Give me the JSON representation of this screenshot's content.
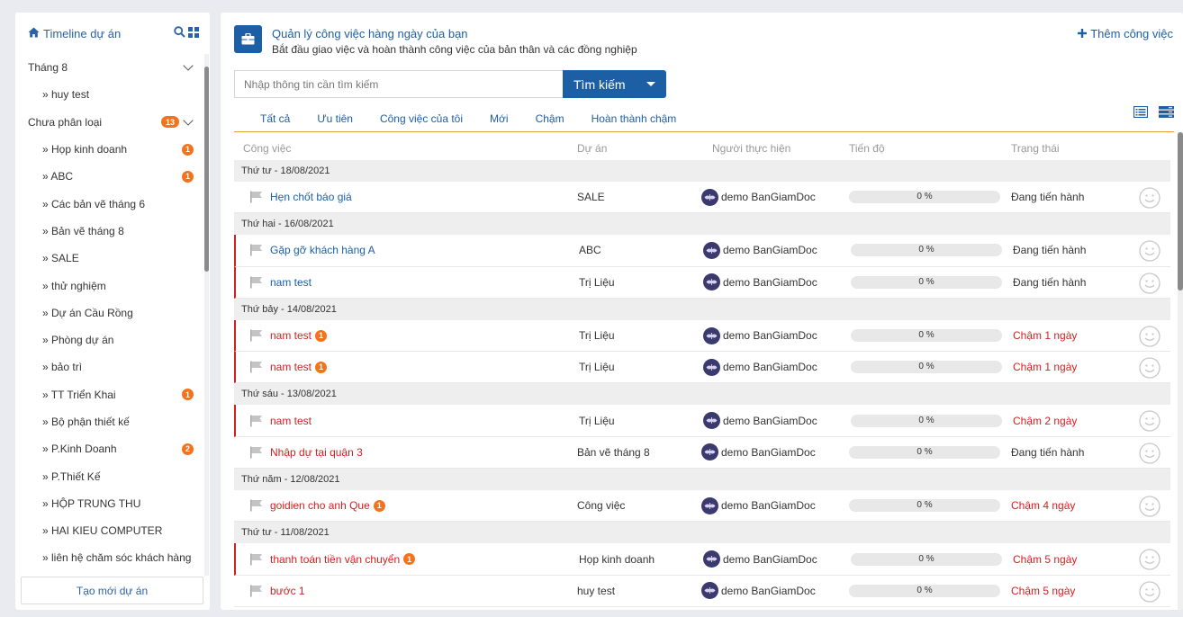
{
  "sidebar": {
    "title": "Timeline dự án",
    "items": [
      {
        "label": "Tháng 8",
        "type": "group",
        "badge": "",
        "expanded": true
      },
      {
        "label": "» huy test",
        "type": "sub",
        "badge": ""
      },
      {
        "label": "Chưa phân loại",
        "type": "group",
        "badge": "13",
        "expanded": true
      },
      {
        "label": "» Họp kinh doanh",
        "type": "sub",
        "badge": "1"
      },
      {
        "label": "» ABC",
        "type": "sub",
        "badge": "1"
      },
      {
        "label": "» Các bản vẽ tháng 6",
        "type": "sub",
        "badge": ""
      },
      {
        "label": "» Bản vẽ tháng 8",
        "type": "sub",
        "badge": ""
      },
      {
        "label": "» SALE",
        "type": "sub",
        "badge": ""
      },
      {
        "label": "» thử nghiệm",
        "type": "sub",
        "badge": ""
      },
      {
        "label": "» Dự án Cầu Rồng",
        "type": "sub",
        "badge": ""
      },
      {
        "label": "» Phòng dự án",
        "type": "sub",
        "badge": ""
      },
      {
        "label": "» bảo trì",
        "type": "sub",
        "badge": ""
      },
      {
        "label": "» TT Triển Khai",
        "type": "sub",
        "badge": "1"
      },
      {
        "label": "» Bộ phận thiết kế",
        "type": "sub",
        "badge": ""
      },
      {
        "label": "» P.Kinh Doanh",
        "type": "sub",
        "badge": "2"
      },
      {
        "label": "» P.Thiết Kế",
        "type": "sub",
        "badge": ""
      },
      {
        "label": "» HỘP TRUNG THU",
        "type": "sub",
        "badge": ""
      },
      {
        "label": "» HAI KIEU COMPUTER",
        "type": "sub",
        "badge": ""
      },
      {
        "label": "» liên hệ chăm sóc khách hàng",
        "type": "sub",
        "badge": ""
      }
    ],
    "create_label": "Tạo mới dự án"
  },
  "header": {
    "title": "Quản lý công việc hàng ngày của bạn",
    "subtitle": "Bắt đầu giao việc và hoàn thành công việc của bản thân và các đồng nghiệp",
    "add_label": "Thêm công việc"
  },
  "search": {
    "placeholder": "Nhập thông tin cần tìm kiếm",
    "button_label": "Tìm kiếm"
  },
  "tabs": [
    "Tất cả",
    "Ưu tiên",
    "Công việc của tôi",
    "Mới",
    "Chậm",
    "Hoàn thành chậm"
  ],
  "columns": {
    "task": "Công việc",
    "project": "Dự án",
    "assignee": "Người thực hiện",
    "progress": "Tiến độ",
    "status": "Trạng thái"
  },
  "groups": [
    {
      "date": "Thứ tư - 18/08/2021",
      "rows": [
        {
          "task": "Hẹn chốt báo giá",
          "badge": "",
          "late": false,
          "alert": false,
          "project": "SALE",
          "assignee": "demo BanGiamDoc",
          "progress": "0 %",
          "status": "Đang tiến hành"
        }
      ]
    },
    {
      "date": "Thứ hai - 16/08/2021",
      "rows": [
        {
          "task": "Gặp gỡ khách hàng A",
          "badge": "",
          "late": false,
          "alert": true,
          "project": "ABC",
          "assignee": "demo BanGiamDoc",
          "progress": "0 %",
          "status": "Đang tiến hành"
        },
        {
          "task": "nam test",
          "badge": "",
          "late": false,
          "alert": true,
          "project": "Trị Liệu",
          "assignee": "demo BanGiamDoc",
          "progress": "0 %",
          "status": "Đang tiến hành"
        }
      ]
    },
    {
      "date": "Thứ bảy - 14/08/2021",
      "rows": [
        {
          "task": "nam test",
          "badge": "1",
          "late": true,
          "alert": true,
          "project": "Trị Liệu",
          "assignee": "demo BanGiamDoc",
          "progress": "0 %",
          "status": "Chậm 1 ngày"
        },
        {
          "task": "nam test",
          "badge": "1",
          "late": true,
          "alert": true,
          "project": "Trị Liệu",
          "assignee": "demo BanGiamDoc",
          "progress": "0 %",
          "status": "Chậm 1 ngày"
        }
      ]
    },
    {
      "date": "Thứ sáu - 13/08/2021",
      "rows": [
        {
          "task": "nam test",
          "badge": "",
          "late": true,
          "alert": true,
          "project": "Trị Liệu",
          "assignee": "demo BanGiamDoc",
          "progress": "0 %",
          "status": "Chậm 2 ngày"
        },
        {
          "task": "Nhập dự tại quận 3",
          "badge": "",
          "late": true,
          "alert": false,
          "project": "Bản vẽ tháng 8",
          "assignee": "demo BanGiamDoc",
          "progress": "0 %",
          "status": "Đang tiến hành"
        }
      ]
    },
    {
      "date": "Thứ năm - 12/08/2021",
      "rows": [
        {
          "task": "goidien cho anh Que",
          "badge": "1",
          "late": true,
          "alert": false,
          "project": "Công việc",
          "assignee": "demo BanGiamDoc",
          "progress": "0 %",
          "status": "Chậm 4 ngày"
        }
      ]
    },
    {
      "date": "Thứ tư - 11/08/2021",
      "rows": [
        {
          "task": "thanh toán tiền vận chuyển",
          "badge": "1",
          "late": true,
          "alert": true,
          "project": "Họp kinh doanh",
          "assignee": "demo BanGiamDoc",
          "progress": "0 %",
          "status": "Chậm 5 ngày"
        },
        {
          "task": "bước 1",
          "badge": "",
          "late": true,
          "alert": false,
          "project": "huy test",
          "assignee": "demo BanGiamDoc",
          "progress": "0 %",
          "status": "Chậm 5 ngày"
        }
      ]
    }
  ],
  "colors": {
    "primary": "#1d5fa5",
    "badge": "#f4731a",
    "late": "#d61f1f",
    "tab_underline": "#e6a23c"
  }
}
